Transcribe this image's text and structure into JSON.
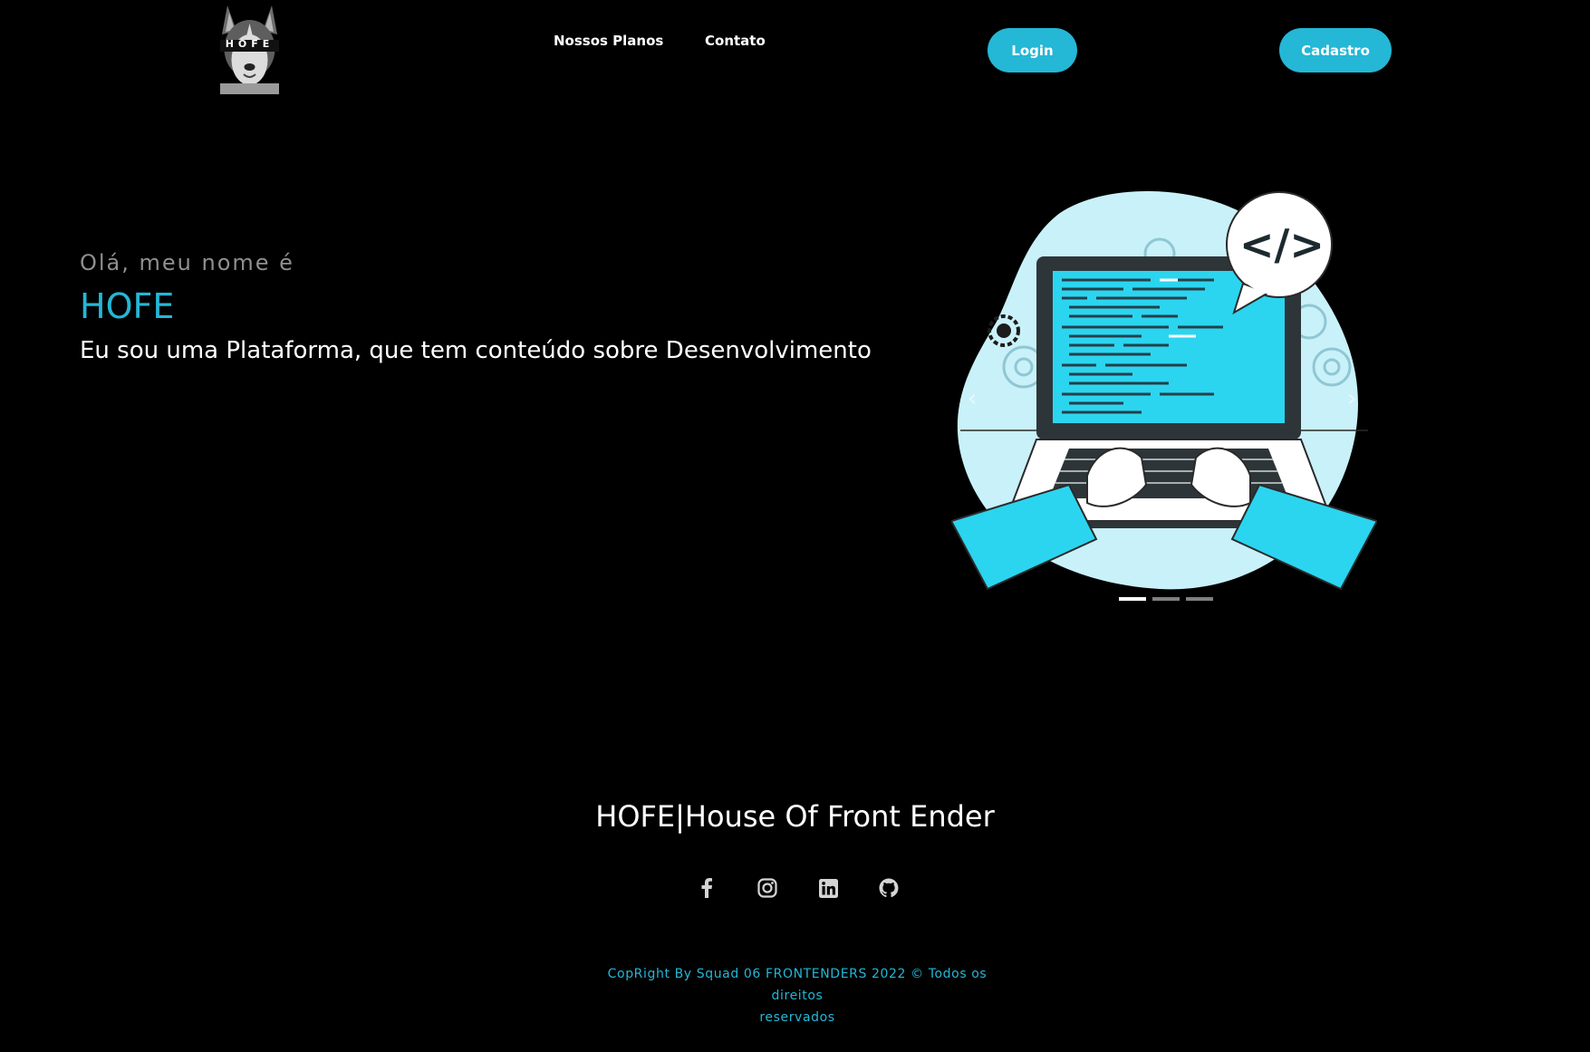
{
  "header": {
    "logo_text": "HOFE",
    "nav": [
      {
        "label": "Nossos Planos"
      },
      {
        "label": "Contato"
      }
    ],
    "login_label": "Login",
    "signup_label": "Cadastro"
  },
  "hero": {
    "greeting": "Olá, meu nome é",
    "name": "HOFE",
    "description": "Eu sou uma Plataforma, que tem conteúdo sobre Desenvolvimento"
  },
  "carousel": {
    "prev_label": "‹",
    "next_label": "›",
    "slide_count": 3,
    "active_index": 0,
    "code_tag": "</>"
  },
  "footer": {
    "title": "HOFE|House Of Front Ender",
    "social_icons": [
      "facebook-icon",
      "instagram-icon",
      "linkedin-icon",
      "github-icon"
    ],
    "copyright_line1": "CopRight By Squad 06 FRONTENDERS 2022 © Todos os direitos",
    "copyright_line2": "reservados"
  },
  "colors": {
    "background": "#000000",
    "accent": "#24b7d6",
    "greeting_gray": "#8f8f8f",
    "text_white": "#ffffff"
  }
}
